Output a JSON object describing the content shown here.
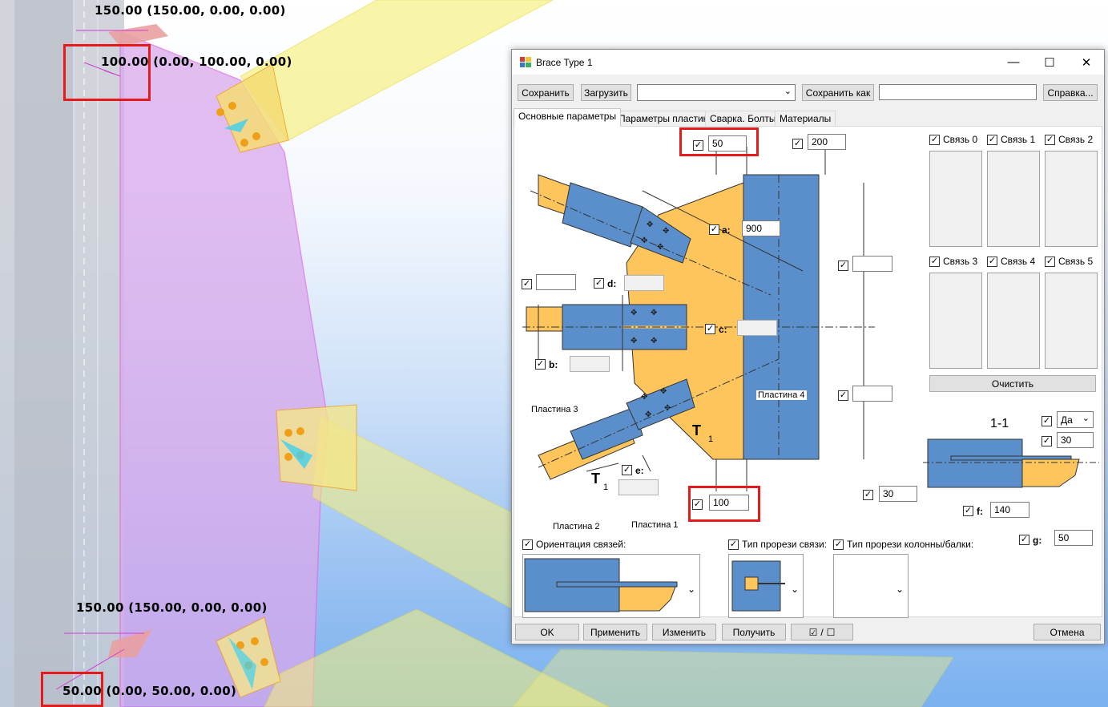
{
  "viewport": {
    "dim_top_1": "150.00 (150.00, 0.00, 0.00)",
    "dim_top_2": "100.00 (0.00, 100.00, 0.00)",
    "dim_bottom_1": "150.00 (150.00, 0.00, 0.00)",
    "dim_bottom_2": "50.00 (0.00, 50.00, 0.00)"
  },
  "dialog": {
    "title": "Brace Type 1",
    "toolbar": {
      "save": "Сохранить",
      "load": "Загрузить",
      "preset_value": "",
      "save_as": "Сохранить как",
      "save_as_name": "",
      "help": "Справка..."
    },
    "tabs": [
      "Основные параметры",
      "Параметры пластин",
      "Сварка. Болты",
      "Материалы"
    ],
    "params": {
      "top_gap": "50",
      "top_right": "200",
      "a_label": "a:",
      "a_value": "900",
      "d_label": "d:",
      "d_value": "",
      "left_value": "",
      "c_label": "c:",
      "c_value": "",
      "b_label": "b:",
      "b_value": "",
      "e_label": "e:",
      "e_value": "",
      "bottom_gap": "100",
      "right_upper": "",
      "right_lower": ""
    },
    "callouts": {
      "plate1": "Пластина 1",
      "plate2": "Пластина 2",
      "plate3": "Пластина 3",
      "plate4": "Пластина 4",
      "section_mark": "1"
    },
    "braces": [
      "Связь 0",
      "Связь 1",
      "Связь 2",
      "Связь 3",
      "Связь 4",
      "Связь 5"
    ],
    "clear_button": "Очистить",
    "section": {
      "title": "1-1",
      "yes_option": "Да",
      "value_30_top": "30",
      "value_30_left": "30",
      "f_label": "f:",
      "f_value": "140",
      "g_label": "g:",
      "g_value": "50"
    },
    "orientation_label": "Ориентация связей:",
    "cut_brace_label": "Тип прорези связи:",
    "cut_column_label": "Тип прорези колонны/балки:",
    "footer": {
      "ok": "OK",
      "apply": "Применить",
      "modify": "Изменить",
      "get": "Получить",
      "toggle": "/",
      "cancel": "Отмена"
    }
  },
  "colors": {
    "plate_orange": "#fdc55c",
    "steel_blue": "#5b8fcb",
    "highlight_red": "#e51b1b"
  }
}
